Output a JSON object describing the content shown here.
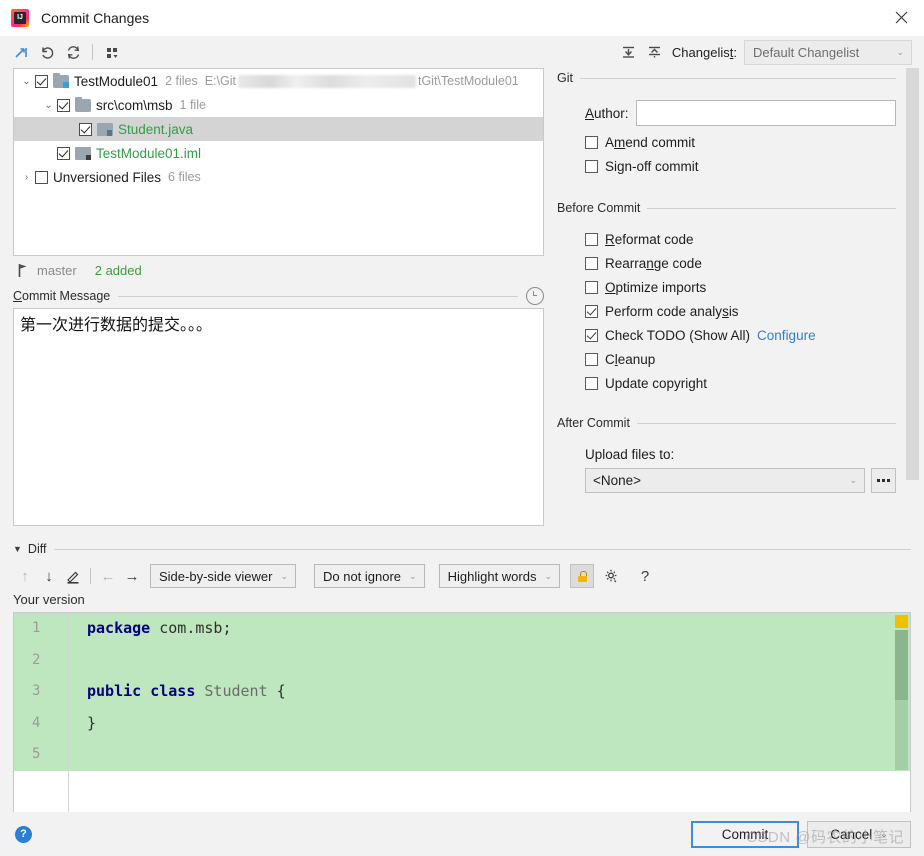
{
  "window": {
    "title": "Commit Changes",
    "app_icon": "intellij-idea-icon",
    "close_icon": "close-icon"
  },
  "toolbar": {
    "icons": [
      {
        "name": "show-diff-icon",
        "glyph": "⤵"
      },
      {
        "name": "revert-icon",
        "glyph": "↶"
      },
      {
        "name": "refresh-icon",
        "glyph": "↻"
      },
      {
        "name": "group-by-icon",
        "glyph": "▦"
      },
      {
        "name": "expand-all-icon",
        "glyph": "↧"
      },
      {
        "name": "collapse-all-icon",
        "glyph": "↥"
      }
    ],
    "changelist_label": "Changelist:",
    "changelist_label_pre": "Changelis",
    "changelist_label_accel": "t",
    "changelist_label_post": ":",
    "changelist_value": "Default Changelist",
    "chevron": "⌄"
  },
  "tree": {
    "rows": [
      {
        "name": "TestModule01",
        "count": "2 files",
        "path_prefix": "E:\\Git",
        "path_suffix": "tGit\\TestModule01",
        "checked": true,
        "expanded": true,
        "indent": 0,
        "icon": "module-icon",
        "green": false,
        "selected": false,
        "blurred": true
      },
      {
        "name": "src\\com\\msb",
        "count": "1 file",
        "checked": true,
        "expanded": true,
        "indent": 1,
        "icon": "folder-icon",
        "green": false,
        "selected": false
      },
      {
        "name": "Student.java",
        "count": "",
        "checked": true,
        "indent": 2,
        "icon": "java-file-icon",
        "green": true,
        "selected": true
      },
      {
        "name": "TestModule01.iml",
        "count": "",
        "checked": true,
        "indent": 1,
        "icon": "iml-file-icon",
        "green": true,
        "selected": false
      },
      {
        "name": "Unversioned Files",
        "count": "6 files",
        "checked": false,
        "expanded": false,
        "indent": 0,
        "icon": "",
        "green": false,
        "selected": false
      }
    ]
  },
  "branch_bar": {
    "icon": "branch-icon",
    "branch": "master",
    "status": "2 added"
  },
  "commit_message": {
    "label_pre": "C",
    "label_accel": "",
    "label": "Commit Message",
    "history_icon": "clock-history-icon",
    "value": "第一次进行数据的提交。。。",
    "placeholder": ""
  },
  "git_panel": {
    "title": "Git",
    "author_label": "Author:",
    "author_value": "",
    "author_placeholder": "",
    "checkboxes": [
      {
        "label": "Amend commit",
        "checked": false,
        "name": "amend-commit"
      },
      {
        "label": "Sign-off commit",
        "checked": false,
        "name": "sign-off-commit"
      }
    ]
  },
  "before_commit": {
    "title": "Before Commit",
    "checkboxes": [
      {
        "label": "Reformat code",
        "checked": false,
        "name": "reformat-code"
      },
      {
        "label": "Rearrange code",
        "checked": false,
        "name": "rearrange-code"
      },
      {
        "label": "Optimize imports",
        "checked": false,
        "name": "optimize-imports"
      },
      {
        "label": "Perform code analysis",
        "checked": true,
        "name": "perform-code-analysis"
      },
      {
        "label": "Check TODO (Show All)",
        "checked": true,
        "name": "check-todo",
        "link": "Configure"
      },
      {
        "label": "Cleanup",
        "checked": false,
        "name": "cleanup"
      },
      {
        "label": "Update copyright",
        "checked": false,
        "name": "update-copyright"
      }
    ]
  },
  "after_commit": {
    "title": "After Commit",
    "upload_label": "Upload files to:",
    "upload_value": "<None>",
    "browse_label": "...",
    "chevron": "⌄"
  },
  "diff": {
    "section_title": "Diff",
    "section_triangle": "▼",
    "toolbar": {
      "prev_diff_icon": "↑",
      "next_diff_icon": "↓",
      "edit_icon": "✎",
      "left_icon": "←",
      "right_icon": "→",
      "viewer_mode": "Side-by-side viewer",
      "whitespace_mode": "Do not ignore",
      "highlight_mode": "Highlight words",
      "lock_icon": "lock-icon",
      "settings_icon": "gear-icon",
      "help_icon": "?",
      "chevron": "⌄"
    },
    "pane_label": "Your version",
    "code_lines": [
      {
        "no": "1",
        "tokens": [
          {
            "t": "package",
            "c": "kw"
          },
          {
            "t": " com.msb;",
            "c": "pl"
          }
        ]
      },
      {
        "no": "2",
        "tokens": []
      },
      {
        "no": "3",
        "tokens": [
          {
            "t": "public class",
            "c": "kw"
          },
          {
            "t": " ",
            "c": "pl"
          },
          {
            "t": "Student",
            "c": "cls"
          },
          {
            "t": " {",
            "c": "pl"
          }
        ]
      },
      {
        "no": "4",
        "tokens": [
          {
            "t": "}",
            "c": "pl"
          }
        ]
      },
      {
        "no": "5",
        "tokens": []
      }
    ]
  },
  "footer": {
    "help_icon": "?",
    "commit_label": "Commit",
    "cancel_label": "Cancel",
    "cancel_chevron": "⌄"
  },
  "watermark": {
    "text": "CSDN @码农的小笔记"
  },
  "colors": {
    "accent": "#3a8ede",
    "added_green": "#3e9c3e",
    "diff_green_bg": "#bee6bf",
    "link_blue": "#2f7fd1",
    "marker_yellow": "#f0c000"
  }
}
